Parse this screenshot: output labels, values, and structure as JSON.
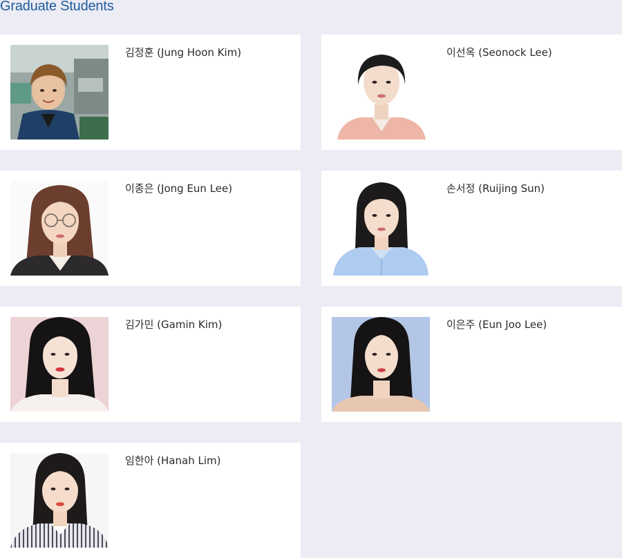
{
  "section": {
    "title": "Graduate Students"
  },
  "students": [
    {
      "name": "김정훈 (Jung Hoon Kim)"
    },
    {
      "name": "이선옥 (Seonock Lee)"
    },
    {
      "name": "이종은 (Jong Eun Lee)"
    },
    {
      "name": "손서정 (Ruijing Sun)"
    },
    {
      "name": "김가민 (Gamin Kim)"
    },
    {
      "name": "이은주 (Eun Joo Lee)"
    },
    {
      "name": "임한아 (Hanah Lim)"
    }
  ],
  "colors": {
    "page_background": "#ececf5",
    "card_background": "#ffffff",
    "title_color": "#1f5a9c",
    "name_color": "#2a2a2a"
  }
}
